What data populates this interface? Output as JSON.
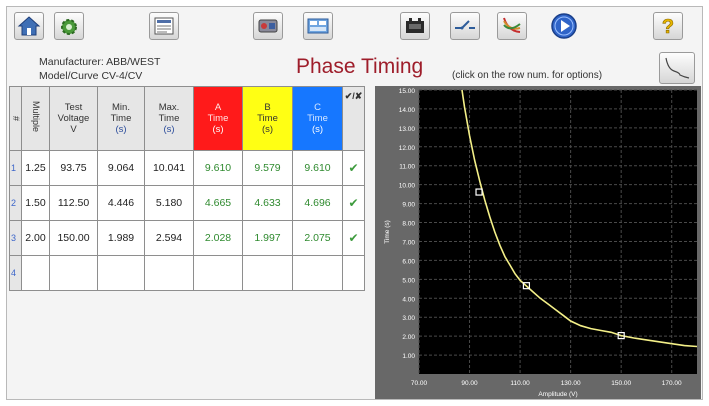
{
  "colors": {
    "title": "#9e1d2a",
    "phase_a": "#ff1a1a",
    "phase_b": "#ffff14",
    "phase_c": "#1677ff",
    "curve": "#f4f088",
    "plot_bg": "#000000"
  },
  "toolbar": {
    "buttons": [
      {
        "name": "home-button",
        "icon": "home-icon"
      },
      {
        "name": "settings-button",
        "icon": "gear-icon"
      },
      {
        "name": "test-report-button",
        "icon": "report-icon"
      },
      {
        "name": "relay-test-button",
        "icon": "relay-icon"
      },
      {
        "name": "test-sheet-button",
        "icon": "sheet-icon"
      },
      {
        "name": "battery-button",
        "icon": "battery-icon"
      },
      {
        "name": "breaker-button",
        "icon": "switch-icon"
      },
      {
        "name": "timing-curves-button",
        "icon": "curves-icon"
      },
      {
        "name": "play-button",
        "icon": "play-icon"
      },
      {
        "name": "help-button",
        "icon": "help-icon"
      },
      {
        "name": "curve-view-button",
        "icon": "curve-icon"
      }
    ]
  },
  "header": {
    "manufacturer_label": "Manufacturer:",
    "manufacturer_value": "ABB/WEST",
    "model_label": "Model/Curve",
    "model_value": "CV-4/CV",
    "title": "Phase Timing",
    "hint": "(click on the row num. for options)"
  },
  "table": {
    "columns": {
      "num": "#",
      "multiple": "Multiple",
      "test_voltage": [
        "Test",
        "Voltage",
        "V"
      ],
      "min_time": [
        "Min.",
        "Time",
        "(s)"
      ],
      "max_time": [
        "Max.",
        "Time",
        "(s)"
      ],
      "a_time": [
        "A",
        "Time",
        "(s)"
      ],
      "b_time": [
        "B",
        "Time",
        "(s)"
      ],
      "c_time": [
        "C",
        "Time",
        "(s)"
      ],
      "pass": "✔/✘"
    },
    "rows": [
      {
        "num": "1",
        "multiple": "1.25",
        "voltage": "93.75",
        "min": "9.064",
        "max": "10.041",
        "a": "9.610",
        "b": "9.579",
        "c": "9.610",
        "pass": "✔"
      },
      {
        "num": "2",
        "multiple": "1.50",
        "voltage": "112.50",
        "min": "4.446",
        "max": "5.180",
        "a": "4.665",
        "b": "4.633",
        "c": "4.696",
        "pass": "✔"
      },
      {
        "num": "3",
        "multiple": "2.00",
        "voltage": "150.00",
        "min": "1.989",
        "max": "2.594",
        "a": "2.028",
        "b": "1.997",
        "c": "2.075",
        "pass": "✔"
      },
      {
        "num": "4",
        "multiple": "",
        "voltage": "",
        "min": "",
        "max": "",
        "a": "",
        "b": "",
        "c": "",
        "pass": ""
      }
    ]
  },
  "chart_data": {
    "type": "line",
    "xlabel": "Amplitude (V)",
    "ylabel": "Time (s)",
    "xlim": [
      70,
      180
    ],
    "ylim": [
      0,
      15
    ],
    "xticks": [
      "70.00",
      "90.00",
      "110.00",
      "130.00",
      "150.00",
      "170.00"
    ],
    "xtick_values": [
      70,
      90,
      110,
      130,
      150,
      170
    ],
    "yticks": [
      "1.00",
      "2.00",
      "3.00",
      "4.00",
      "5.00",
      "6.00",
      "7.00",
      "8.00",
      "9.00",
      "10.00",
      "11.00",
      "12.00",
      "13.00",
      "14.00",
      "15.00"
    ],
    "ytick_values": [
      1,
      2,
      3,
      4,
      5,
      6,
      7,
      8,
      9,
      10,
      11,
      12,
      13,
      14,
      15
    ],
    "grid": true,
    "series": [
      {
        "x": [
          87.0,
          88,
          90,
          92,
          94,
          96,
          98,
          100,
          102,
          104,
          106,
          108,
          110,
          112.5,
          115,
          118,
          121,
          124,
          127,
          130,
          134,
          138,
          142,
          146,
          150,
          155,
          160,
          165,
          170,
          175,
          180
        ],
        "y": [
          15.0,
          14.1,
          12.6,
          11.3,
          10.2,
          9.2,
          8.3,
          7.5,
          6.8,
          6.2,
          5.75,
          5.3,
          4.95,
          4.65,
          4.35,
          4.0,
          3.7,
          3.4,
          3.1,
          2.8,
          2.55,
          2.4,
          2.3,
          2.2,
          2.03,
          1.9,
          1.8,
          1.7,
          1.6,
          1.5,
          1.45
        ]
      }
    ],
    "test_points": {
      "x": [
        93.75,
        112.5,
        150.0
      ],
      "y": [
        9.61,
        4.665,
        2.028
      ]
    }
  }
}
